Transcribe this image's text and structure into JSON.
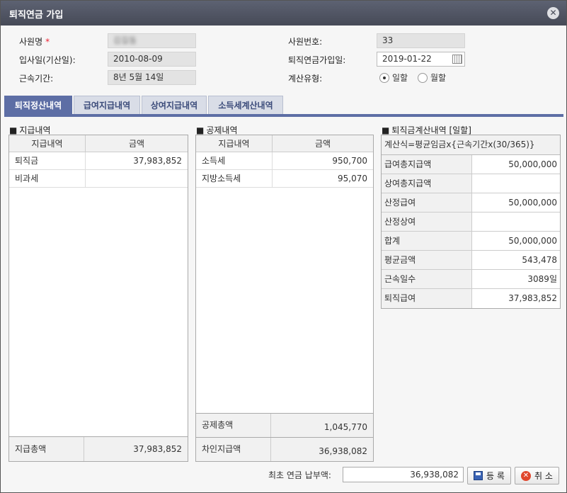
{
  "window": {
    "title": "퇴직연금 가입",
    "close_glyph": "✕"
  },
  "form": {
    "employee_name_label": "사원명",
    "employee_name_required": "*",
    "employee_name_value": "김길동",
    "employee_no_label": "사원번호:",
    "employee_no_value": "33",
    "hire_date_label": "입사일(기산일):",
    "hire_date_value": "2010-08-09",
    "join_date_label": "퇴직연금가입일:",
    "join_date_value": "2019-01-22",
    "service_label": "근속기간:",
    "service_value": "8년 5월 14일",
    "calc_type_label": "계산유형:",
    "calc_type_options": [
      "일할",
      "월할"
    ],
    "calc_type_selected": "일할"
  },
  "tabs": [
    {
      "label": "퇴직정산내역",
      "active": true
    },
    {
      "label": "급여지급내역",
      "active": false
    },
    {
      "label": "상여지급내역",
      "active": false
    },
    {
      "label": "소득세계산내역",
      "active": false
    }
  ],
  "payments": {
    "title": "지급내역",
    "headers": [
      "지급내역",
      "금액"
    ],
    "rows": [
      [
        "퇴직금",
        "37,983,852"
      ],
      [
        "비과세",
        ""
      ]
    ],
    "total_label": "지급총액",
    "total_value": "37,983,852"
  },
  "deductions": {
    "title": "공제내역",
    "headers": [
      "지급내역",
      "금액"
    ],
    "rows": [
      [
        "소득세",
        "950,700"
      ],
      [
        "지방소득세",
        "95,070"
      ]
    ],
    "total_label": "공제총액",
    "total_value": "1,045,770",
    "net_label": "차인지급액",
    "net_value": "36,938,082"
  },
  "calc": {
    "title": "퇴직금계산내역 [일할]",
    "formula": "계산식=평균임금x{근속기간x(30/365)}",
    "rows": [
      [
        "급여총지급액",
        "50,000,000"
      ],
      [
        "상여총지급액",
        ""
      ],
      [
        "산정급여",
        "50,000,000"
      ],
      [
        "산정상여",
        ""
      ],
      [
        "합계",
        "50,000,000"
      ],
      [
        "평균금액",
        "543,478"
      ],
      [
        "근속일수",
        "3089일"
      ],
      [
        "퇴직급여",
        "37,983,852"
      ]
    ]
  },
  "bottom": {
    "first_payment_label": "최초 연금 납부액:",
    "first_payment_value": "36,938,082",
    "register_label": "등 록",
    "cancel_label": "취 소"
  },
  "colors": {
    "tab_active": "#5d6ea5",
    "titlebar": "#4e525f",
    "required": "#e23333"
  },
  "icons": [
    "close-icon",
    "calendar-icon",
    "save-icon",
    "cancel-icon"
  ]
}
